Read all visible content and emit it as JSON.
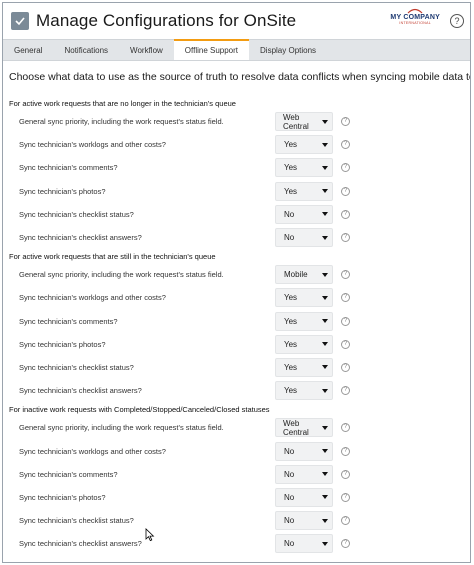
{
  "app": {
    "title": "Manage Configurations for OnSite",
    "company_name": "MY COMPANY",
    "company_sub": "INTERNATIONAL",
    "help_glyph": "?"
  },
  "tabs": [
    {
      "label": "General",
      "active": false
    },
    {
      "label": "Notifications",
      "active": false
    },
    {
      "label": "Workflow",
      "active": false
    },
    {
      "label": "Offline Support",
      "active": true
    },
    {
      "label": "Display Options",
      "active": false
    }
  ],
  "heading": "Choose what data to use as the source of truth to resolve data conflicts when syncing mobile data to Web Central.",
  "sections": [
    {
      "title": "For active work requests that are no longer in the technician's queue",
      "rows": [
        {
          "label": "General sync priority, including the work request's status field.",
          "value": "Web Central"
        },
        {
          "label": "Sync technician's worklogs and other costs?",
          "value": "Yes"
        },
        {
          "label": "Sync technician's comments?",
          "value": "Yes"
        },
        {
          "label": "Sync technician's photos?",
          "value": "Yes"
        },
        {
          "label": "Sync technician's checklist status?",
          "value": "No"
        },
        {
          "label": "Sync technician's checklist answers?",
          "value": "No"
        }
      ]
    },
    {
      "title": "For active work requests that are still in the technician's queue",
      "rows": [
        {
          "label": "General sync priority, including the work request's status field.",
          "value": "Mobile"
        },
        {
          "label": "Sync technician's worklogs and other costs?",
          "value": "Yes"
        },
        {
          "label": "Sync technician's comments?",
          "value": "Yes"
        },
        {
          "label": "Sync technician's photos?",
          "value": "Yes"
        },
        {
          "label": "Sync technician's checklist status?",
          "value": "Yes"
        },
        {
          "label": "Sync technician's checklist answers?",
          "value": "Yes"
        }
      ]
    },
    {
      "title": "For inactive work requests with Completed/Stopped/Canceled/Closed statuses",
      "rows": [
        {
          "label": "General sync priority, including the work request's status field.",
          "value": "Web Central"
        },
        {
          "label": "Sync technician's worklogs and other costs?",
          "value": "No"
        },
        {
          "label": "Sync technician's comments?",
          "value": "No"
        },
        {
          "label": "Sync technician's photos?",
          "value": "No"
        },
        {
          "label": "Sync technician's checklist status?",
          "value": "No"
        },
        {
          "label": "Sync technician's checklist answers?",
          "value": "No"
        }
      ]
    }
  ]
}
